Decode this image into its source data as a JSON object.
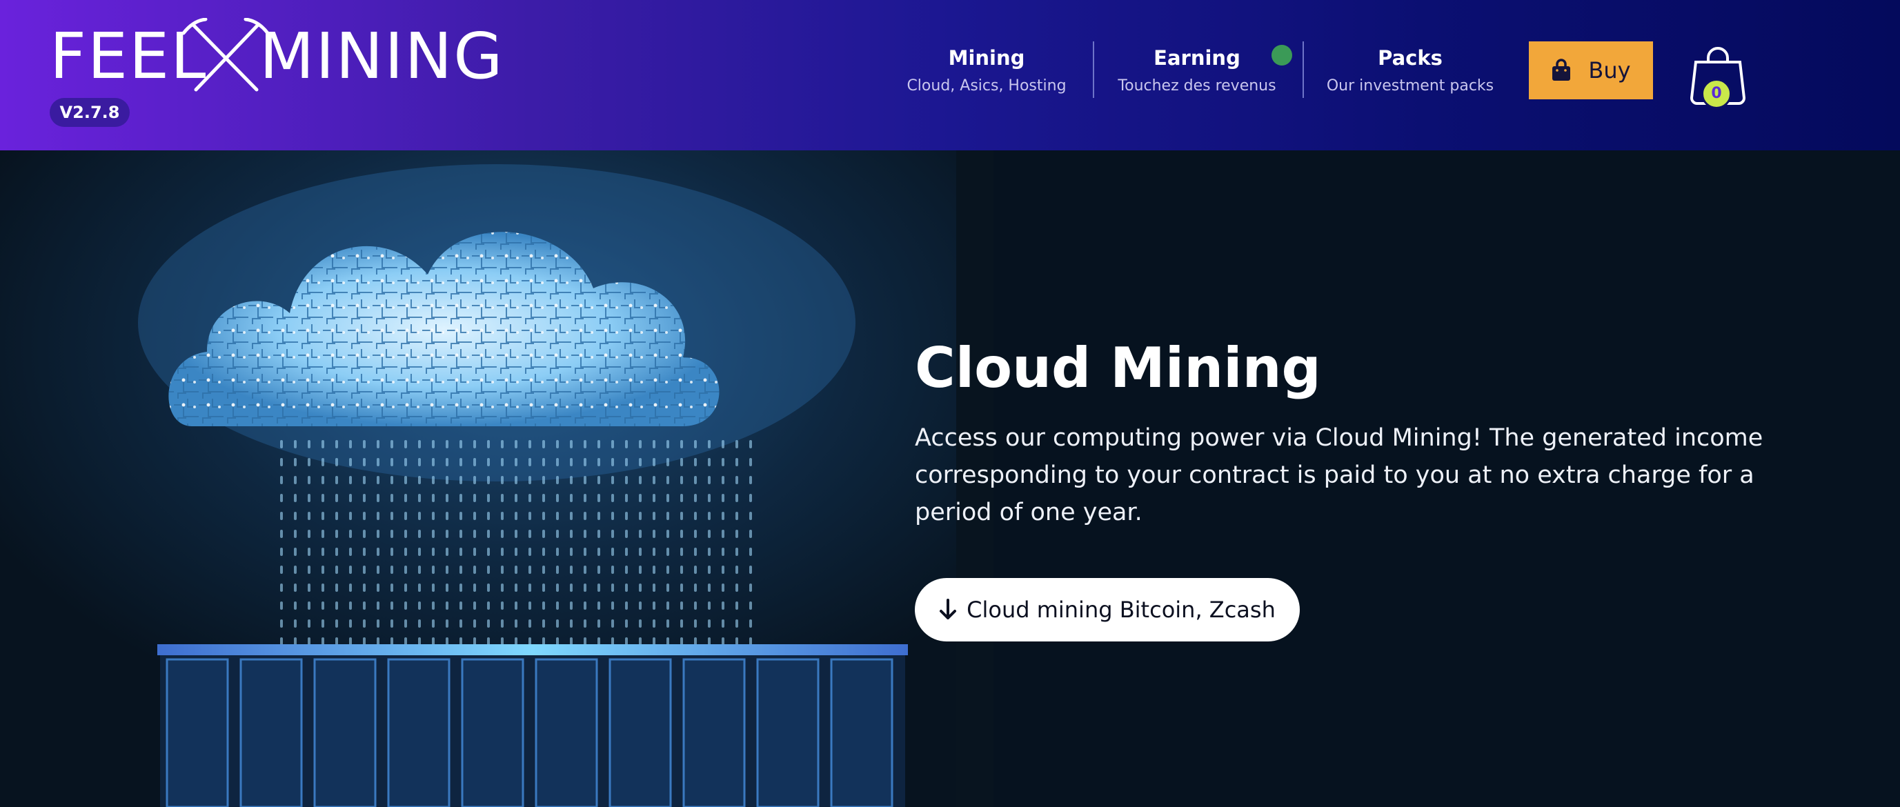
{
  "brand": {
    "logo_left": "FEEL",
    "logo_right": "MINING",
    "version": "V2.7.8",
    "colors": {
      "header_start": "#6a22dc",
      "header_end": "#040a5c",
      "accent": "#f2a73a",
      "status": "#3b9a57"
    }
  },
  "nav": {
    "items": [
      {
        "title": "Mining",
        "subtitle": "Cloud, Asics, Hosting"
      },
      {
        "title": "Earning",
        "subtitle": "Touchez des revenus"
      },
      {
        "title": "Packs",
        "subtitle": "Our investment packs"
      }
    ],
    "buy_label": "Buy",
    "buy_icon": "shopping-bag-icon",
    "cart_icon": "cart-bag-icon",
    "cart_count": "0"
  },
  "hero": {
    "title": "Cloud Mining",
    "description": "Access our computing power via Cloud Mining! The generated income corresponding to your contract is paid to you at no extra charge for a period of one year.",
    "cta_label": "Cloud mining Bitcoin, Zcash",
    "cta_icon": "arrow-down-icon",
    "image": "circuit-cloud-over-server-racks"
  }
}
